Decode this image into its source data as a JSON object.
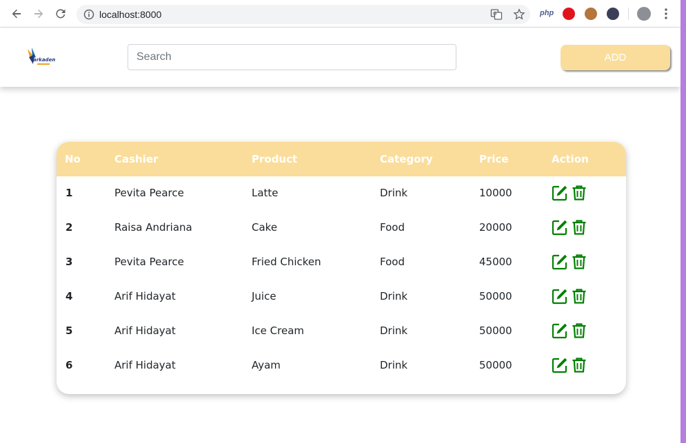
{
  "browser": {
    "url": "localhost:8000",
    "icons": {
      "back": "arrow-left-icon",
      "forward": "arrow-right-icon",
      "reload": "reload-icon",
      "info": "info-icon",
      "translate": "translate-icon",
      "bookmark": "star-icon",
      "menu": "kebab-menu-icon"
    },
    "extensions": {
      "php_label": "php"
    }
  },
  "header": {
    "logo_text": "arkademy",
    "search_placeholder": "Search",
    "add_label": "ADD"
  },
  "colors": {
    "accent": "#fadd9b",
    "action": "#008000",
    "frame": "#b57fe0"
  },
  "table": {
    "headers": [
      "No",
      "Cashier",
      "Product",
      "Category",
      "Price",
      "Action"
    ],
    "rows": [
      {
        "no": "1",
        "cashier": "Pevita Pearce",
        "product": "Latte",
        "category": "Drink",
        "price": "10000"
      },
      {
        "no": "2",
        "cashier": "Raisa Andriana",
        "product": "Cake",
        "category": "Food",
        "price": "20000"
      },
      {
        "no": "3",
        "cashier": "Pevita Pearce",
        "product": "Fried Chicken",
        "category": "Food",
        "price": "45000"
      },
      {
        "no": "4",
        "cashier": "Arif Hidayat",
        "product": "Juice",
        "category": "Drink",
        "price": "50000"
      },
      {
        "no": "5",
        "cashier": "Arif Hidayat",
        "product": "Ice Cream",
        "category": "Drink",
        "price": "50000"
      },
      {
        "no": "6",
        "cashier": "Arif Hidayat",
        "product": "Ayam",
        "category": "Drink",
        "price": "50000"
      }
    ]
  }
}
